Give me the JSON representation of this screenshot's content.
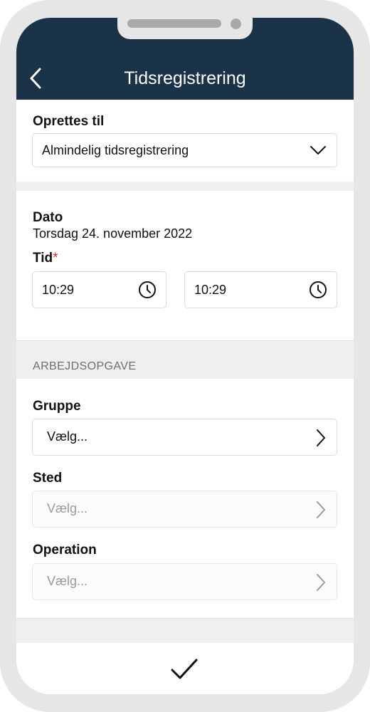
{
  "header": {
    "title": "Tidsregistrering",
    "background_color": "#1b3349",
    "back_icon": "chevron-left-icon"
  },
  "create_for": {
    "label": "Oprettes til",
    "selected_value": "Almindelig tidsregistrering",
    "icon": "chevron-down-icon"
  },
  "date": {
    "label": "Dato",
    "value": "Torsdag 24. november 2022"
  },
  "time": {
    "label": "Tid",
    "required_marker": "*",
    "start": "10:29",
    "end": "10:29",
    "icon": "clock-icon"
  },
  "task_section": {
    "header": "ARBEJDSOPGAVE",
    "fields": [
      {
        "label": "Gruppe",
        "placeholder": "Vælg...",
        "enabled": true
      },
      {
        "label": "Sted",
        "placeholder": "Vælg...",
        "enabled": false
      },
      {
        "label": "Operation",
        "placeholder": "Vælg...",
        "enabled": false
      }
    ]
  },
  "footer": {
    "confirm_icon": "checkmark-icon"
  },
  "colors": {
    "required": "#d3302f",
    "section_background": "#efefef"
  }
}
